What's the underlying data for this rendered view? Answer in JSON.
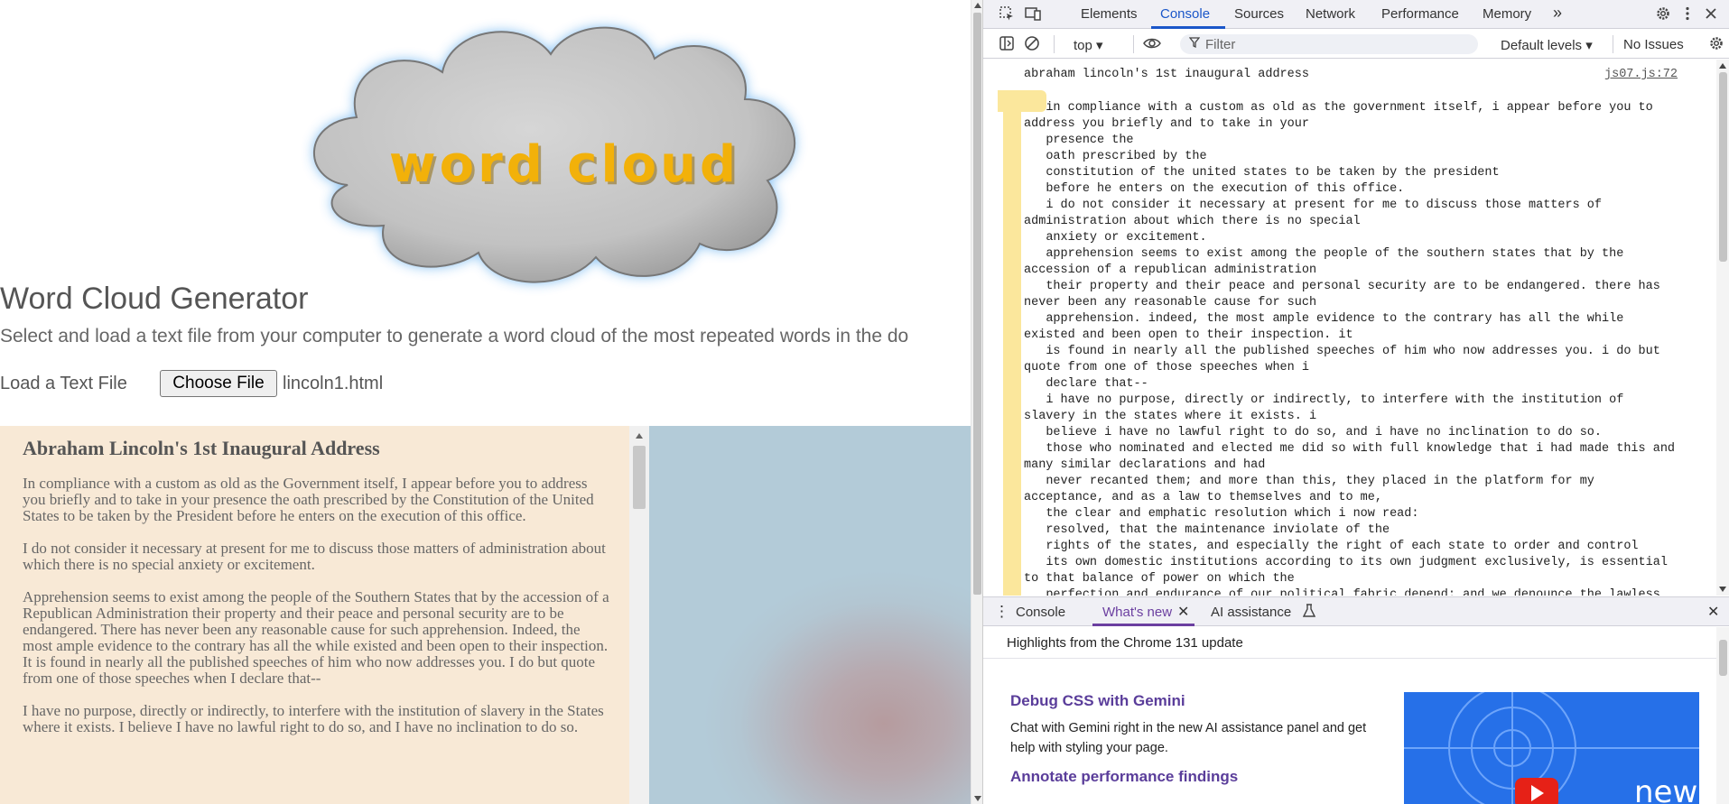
{
  "webpage": {
    "logo_text": "word cloud",
    "title": "Word Cloud Generator",
    "subtitle": "Select and load a text file from your computer to generate a word cloud of the most repeated words in the do",
    "load_label": "Load a Text File",
    "choose_button": "Choose File",
    "file_name": "lincoln1.html",
    "document": {
      "heading": "Abraham Lincoln's 1st Inaugural Address",
      "paragraphs": [
        "In compliance with a custom as old as the Government itself, I appear before you to address you briefly and to take in your presence the oath prescribed by the Constitution of the United States to be taken by the President before he enters on the execution of this office.",
        "I do not consider it necessary at present for me to discuss those matters of administration about which there is no special anxiety or excitement.",
        "Apprehension seems to exist among the people of the Southern States that by the accession of a Republican Administration their property and their peace and personal security are to be endangered. There has never been any reasonable cause for such apprehension. Indeed, the most ample evidence to the contrary has all the while existed and been open to their inspection. It is found in nearly all the published speeches of him who now addresses you. I do but quote from one of those speeches when I declare that--",
        "I have no purpose, directly or indirectly, to interfere with the institution of slavery in the States where it exists. I believe I have no lawful right to do so, and I have no inclination to do so."
      ]
    }
  },
  "devtools": {
    "tabs": [
      "Elements",
      "Console",
      "Sources",
      "Network",
      "Performance",
      "Memory"
    ],
    "active_tab": "Console",
    "more_tabs": "»",
    "toolbar": {
      "context": "top ▾",
      "filter_placeholder": "Filter",
      "levels": "Default levels ▾",
      "issues": "No Issues"
    },
    "console": {
      "log_header": "abraham lincoln's 1st inaugural address",
      "log_source": "js07.js:72",
      "log_body": "   in compliance with a custom as old as the government itself, i appear before you to\naddress you briefly and to take in your\n   presence the\n   oath prescribed by the\n   constitution of the united states to be taken by the president\n   before he enters on the execution of this office.\n   i do not consider it necessary at present for me to discuss those matters of\nadministration about which there is no special\n   anxiety or excitement.\n   apprehension seems to exist among the people of the southern states that by the\naccession of a republican administration\n   their property and their peace and personal security are to be endangered. there has\nnever been any reasonable cause for such\n   apprehension. indeed, the most ample evidence to the contrary has all the while\nexisted and been open to their inspection. it\n   is found in nearly all the published speeches of him who now addresses you. i do but\nquote from one of those speeches when i\n   declare that--\n   i have no purpose, directly or indirectly, to interfere with the institution of\nslavery in the states where it exists. i\n   believe i have no lawful right to do so, and i have no inclination to do so.\n   those who nominated and elected me did so with full knowledge that i had made this and\nmany similar declarations and had\n   never recanted them; and more than this, they placed in the platform for my\nacceptance, and as a law to themselves and to me,\n   the clear and emphatic resolution which i now read:\n   resolved, that the maintenance inviolate of the\n   rights of the states, and especially the right of each state to order and control\n   its own domestic institutions according to its own judgment exclusively, is essential\nto that balance of power on which the\n   perfection and endurance of our political fabric depend; and we denounce the lawless"
    },
    "drawer": {
      "tabs": [
        "Console",
        "What's new",
        "AI assistance"
      ],
      "active_tab": "What's new",
      "highlights": "Highlights from the Chrome 131 update",
      "item1_title": "Debug CSS with Gemini",
      "item1_desc": "Chat with Gemini right in the new AI assistance panel and get help with styling your page.",
      "item2_title": "Annotate performance findings",
      "video_text": "new"
    }
  },
  "colors": {
    "logo_text": "#f2b10a",
    "cloud_fill": "#c4c4c4",
    "doc_bg": "#f8e9d6",
    "devtools_accent": "#1a56c9",
    "whatsnew_accent": "#6b3fa0",
    "highlight": "#fbe79c"
  }
}
